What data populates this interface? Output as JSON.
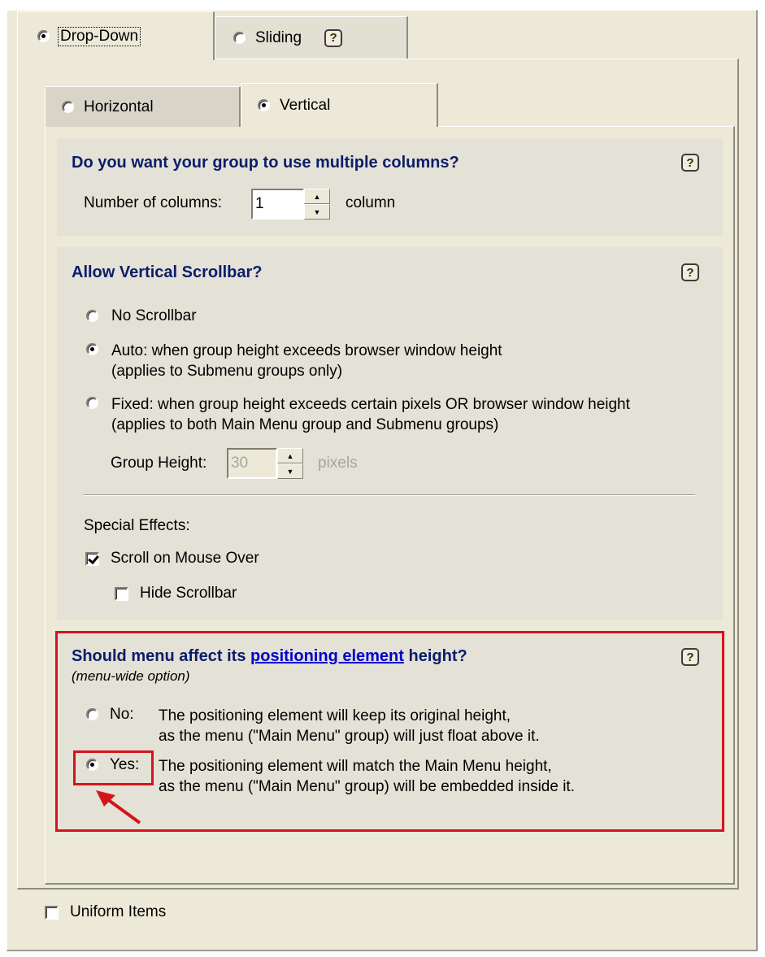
{
  "outer_tabs": [
    {
      "label": "Drop-Down",
      "selected": true
    },
    {
      "label": "Sliding",
      "selected": false
    }
  ],
  "inner_tabs": [
    {
      "label": "Horizontal",
      "selected": false
    },
    {
      "label": "Vertical",
      "selected": true
    }
  ],
  "columns_section": {
    "title": "Do you want your group to use multiple columns?",
    "field_label": "Number of columns:",
    "value": "1",
    "unit": "column"
  },
  "scrollbar_section": {
    "title": "Allow Vertical Scrollbar?",
    "options": [
      {
        "line1": "No Scrollbar",
        "line2": "",
        "selected": false
      },
      {
        "line1": "Auto: when group height exceeds browser window height",
        "line2": "(applies to Submenu groups only)",
        "selected": true
      },
      {
        "line1": "Fixed: when group height exceeds certain pixels OR browser window height",
        "line2": "(applies to both Main Menu group and Submenu groups)",
        "selected": false
      }
    ],
    "group_height_label": "Group Height:",
    "group_height_value": "30",
    "group_height_unit": "pixels",
    "special_effects_label": "Special Effects:",
    "scroll_on_mouse_over": {
      "label": "Scroll on Mouse Over",
      "checked": true
    },
    "hide_scrollbar": {
      "label": "Hide Scrollbar",
      "checked": false
    }
  },
  "positioning_section": {
    "title_prefix": "Should menu affect its",
    "title_link": "positioning element",
    "title_suffix": "height?",
    "subtitle": "(menu-wide option)",
    "options": [
      {
        "label": "No:",
        "line1": "The positioning element will keep its original height,",
        "line2": "as the menu (\"Main Menu\" group) will just float above it.",
        "selected": false
      },
      {
        "label": "Yes:",
        "line1": "The positioning element will match the Main Menu height,",
        "line2": "as the menu (\"Main Menu\" group) will be embedded inside it.",
        "selected": true
      }
    ],
    "highlight_color": "#d4141c"
  },
  "uniform_items": {
    "label": "Uniform Items",
    "checked": false
  },
  "help_glyph": "?",
  "colors": {
    "title": "#0a1d6a",
    "highlight": "#d4141c",
    "panel": "#ece9d8"
  }
}
